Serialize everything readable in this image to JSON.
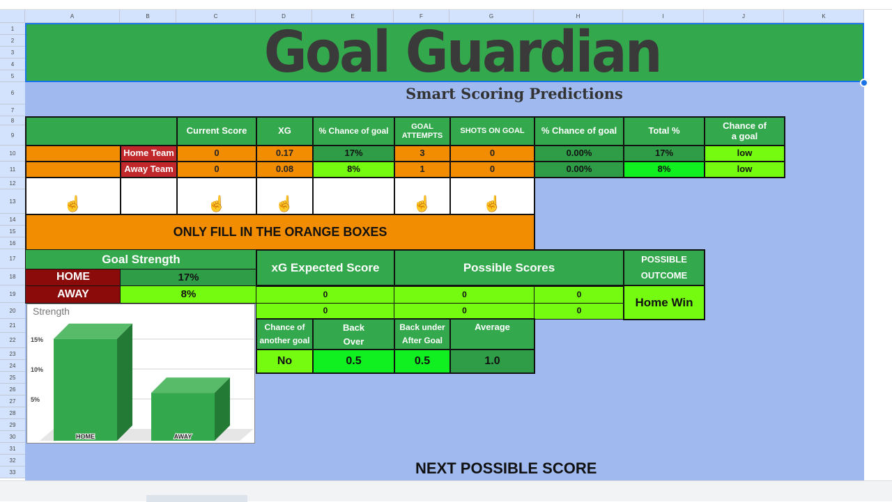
{
  "columns": [
    "A",
    "B",
    "C",
    "D",
    "E",
    "F",
    "G",
    "H",
    "I",
    "J",
    "K"
  ],
  "rows": [
    "1",
    "2",
    "3",
    "4",
    "5",
    "6",
    "7",
    "8",
    "9",
    "10",
    "11",
    "12",
    "13",
    "14",
    "15",
    "16",
    "17",
    "18",
    "19",
    "20",
    "21",
    "22",
    "23",
    "24",
    "25",
    "26",
    "27",
    "28",
    "29",
    "30",
    "31",
    "32",
    "33"
  ],
  "title": "Goal Guardian",
  "subtitle": "Smart Scoring Predictions",
  "stats": {
    "headers": [
      "Current Score",
      "XG",
      "% Chance of goal",
      "GOAL ATTEMPTS",
      "SHOTS ON GOAL",
      "% Chance of goal",
      "Total %",
      "Chance of a goal"
    ],
    "home": {
      "label": "Home Team",
      "current_score": "0",
      "xg": "0.17",
      "chance": "17%",
      "attempts": "3",
      "shots": "0",
      "chance2": "0.00%",
      "total": "17%",
      "chance_of_goal": "low"
    },
    "away": {
      "label": "Away Team",
      "current_score": "0",
      "xg": "0.08",
      "chance": "8%",
      "attempts": "1",
      "shots": "0",
      "chance2": "0.00%",
      "total": "8%",
      "chance_of_goal": "low"
    },
    "pointer_icon": "backhand-index-pointing-up"
  },
  "instruction": "ONLY FILL IN THE ORANGE BOXES",
  "goal_strength": {
    "title": "Goal Strength",
    "home_label": "HOME",
    "home_value": "17%",
    "away_label": "AWAY",
    "away_value": "8%"
  },
  "expected": {
    "xg_header": "xG Expected Score",
    "possible_header": "Possible Scores",
    "outcome_header": "POSSIBLE OUTCOME",
    "xg_home": "0",
    "xg_away": "0",
    "poss_home": "0",
    "poss_away": "0",
    "poss_home2": "0",
    "poss_away2": "0",
    "outcome": "Home Win"
  },
  "extra": {
    "headers": [
      "Chance of another goal",
      "Back Over",
      "Back under After Goal",
      "Average"
    ],
    "values": [
      "No",
      "0.5",
      "0.5",
      "1.0"
    ]
  },
  "next_label": "NEXT POSSIBLE SCORE",
  "chart_data": {
    "type": "bar",
    "title": "Strength",
    "categories": [
      "HOME",
      "AWAY"
    ],
    "values": [
      17,
      8
    ],
    "ytick_labels": [
      "5%",
      "10%",
      "15%"
    ],
    "yticks": [
      5,
      10,
      15
    ],
    "style": "3d",
    "color": "#34a84c",
    "grid": true
  },
  "colors": {
    "header_green": "#34a84c",
    "input_orange": "#f28c00",
    "light_green": "#75fb10",
    "sheet_blue": "#a0baf0"
  }
}
